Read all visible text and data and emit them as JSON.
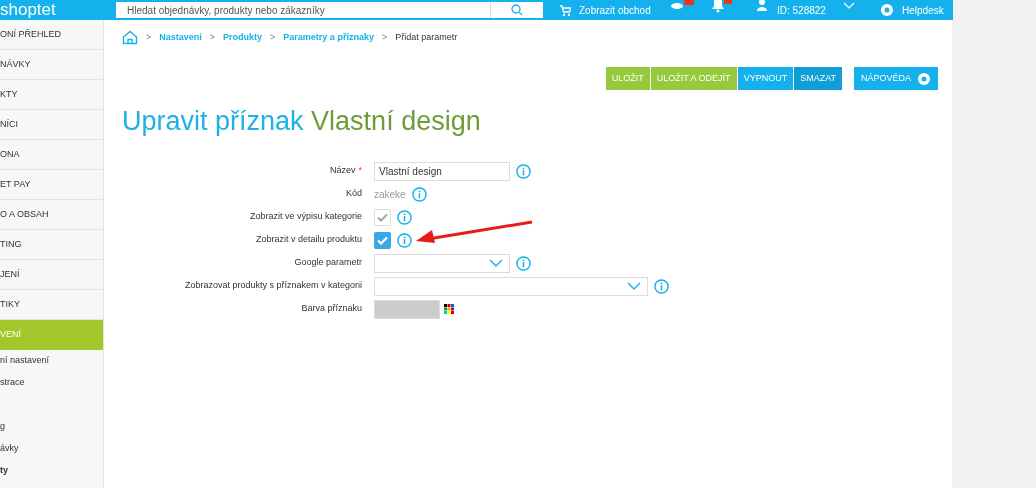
{
  "topbar": {
    "logo": "shoptet",
    "search": {
      "placeholder": "Hledat objednávky, produkty nebo zákazníky"
    },
    "shop_link": "Zobrazit obchod",
    "account_id": "ID: 528822",
    "helpdesk": "Helpdesk"
  },
  "sidebar": {
    "items": [
      {
        "label": "ONÍ PŘEHLED",
        "selected": false
      },
      {
        "label": "NÁVKY",
        "selected": false
      },
      {
        "label": "KTY",
        "selected": false
      },
      {
        "label": "NÍCI",
        "selected": false
      },
      {
        "label": "ONA",
        "selected": false
      },
      {
        "label": "ET PAY",
        "selected": false
      },
      {
        "label": "O A OBSAH",
        "selected": false
      },
      {
        "label": "TING",
        "selected": false
      },
      {
        "label": "JENÍ",
        "selected": false
      },
      {
        "label": "TIKY",
        "selected": false
      },
      {
        "label": "VENÍ",
        "selected": true
      }
    ],
    "subitems": [
      {
        "label": "ní nastavení",
        "selected": false
      },
      {
        "label": "strace",
        "selected": false
      },
      {
        "label": "g",
        "selected": false
      },
      {
        "label": "ávky",
        "selected": false
      },
      {
        "label": "ty",
        "selected": true
      }
    ]
  },
  "breadcrumb": [
    {
      "separator": ">",
      "label": "Nastavení",
      "kind": "link"
    },
    {
      "separator": ">",
      "label": "Produkty",
      "kind": "link"
    },
    {
      "separator": ">",
      "label": "Parametry a příznaky",
      "kind": "link"
    },
    {
      "separator": ">",
      "label": "Přidat parametr",
      "kind": "current"
    }
  ],
  "actions": [
    {
      "label": "ULOŽIT",
      "color": "#97c93d"
    },
    {
      "label": "ULOŽIT A ODEJÍT",
      "color": "#97c93d"
    },
    {
      "label": "VYPNOUT",
      "color": "#14b1ec"
    },
    {
      "label": "SMAZAT",
      "color": "#0f9fd6"
    }
  ],
  "help_button": "NÁPOVĚDA",
  "heading": {
    "prefix": "Upravit příznak",
    "name": "Vlastní design"
  },
  "form": [
    {
      "label": "Název",
      "required_mark": "*",
      "kind": "text",
      "value": "Vlastní design",
      "info": true
    },
    {
      "label": "Kód",
      "kind": "static",
      "value": "zakeke",
      "info": true
    },
    {
      "label": "Zobrazit ve výpisu kategorie",
      "kind": "checkbox",
      "checked": true,
      "disabled": true,
      "info": true
    },
    {
      "label": "Zobrazit v detailu produktu",
      "kind": "checkbox",
      "checked": true,
      "disabled": false,
      "info": true
    },
    {
      "label": "Google parametr",
      "kind": "select",
      "wide": false,
      "info": true
    },
    {
      "label": "Zobrazovat produkty s příznakem v kategorii",
      "kind": "select",
      "wide": true,
      "info": true
    },
    {
      "label": "Barva příznaku",
      "kind": "color",
      "color": "#cccccc",
      "info": false
    }
  ]
}
